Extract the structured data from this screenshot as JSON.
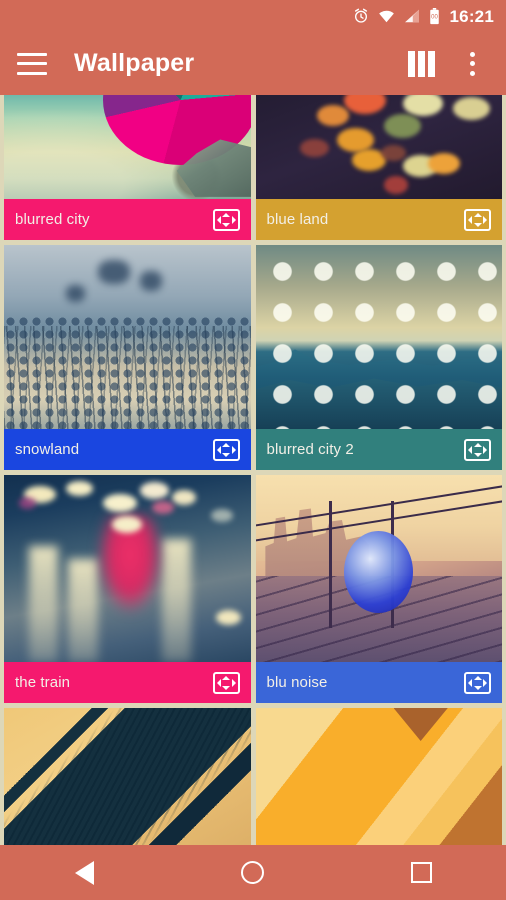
{
  "status_bar": {
    "icons": [
      "alarm-icon",
      "wifi-icon",
      "signal-icon",
      "battery-icon"
    ],
    "clock": "16:21"
  },
  "app_bar": {
    "menu_icon": "hamburger-menu-icon",
    "title": "Wallpaper",
    "grid_icon": "grid-columns-icon",
    "overflow_icon": "overflow-menu-icon"
  },
  "theme": {
    "app_bar_color": "#D26A57",
    "page_background": "#DDD7B8",
    "label_text_color": "#F2EFE6"
  },
  "wallpapers": [
    {
      "name": "blurred city",
      "label_color": "#F5196E",
      "action_icon": "fit-to-screen-icon",
      "art_class": "art-blurredcity",
      "art_height": 104
    },
    {
      "name": "blue land",
      "label_color": "#D4A130",
      "action_icon": "fit-to-screen-icon",
      "art_class": "art-blueland",
      "art_height": 104
    },
    {
      "name": "snowland",
      "label_color": "#1A46E0",
      "action_icon": "fit-to-screen-icon",
      "art_class": "art-snowland",
      "art_height": 184
    },
    {
      "name": "blurred city 2",
      "label_color": "#31807D",
      "action_icon": "fit-to-screen-icon",
      "art_class": "art-bc2",
      "art_height": 184
    },
    {
      "name": "the train",
      "label_color": "#F5196E",
      "action_icon": "fit-to-screen-icon",
      "art_class": "art-thetrain",
      "art_height": 187
    },
    {
      "name": "blu noise",
      "label_color": "#3A66D8",
      "action_icon": "fit-to-screen-icon",
      "art_class": "art-blunoise",
      "art_height": 187
    },
    {
      "name": "",
      "label_color": "",
      "action_icon": "",
      "art_class": "art-glitch",
      "art_height": 145,
      "partial": true
    },
    {
      "name": "",
      "label_color": "",
      "action_icon": "",
      "art_class": "art-stripes",
      "art_height": 145,
      "partial": true
    }
  ],
  "nav_bar": {
    "back_label": "back-button",
    "home_label": "home-button",
    "recents_label": "recents-button"
  }
}
